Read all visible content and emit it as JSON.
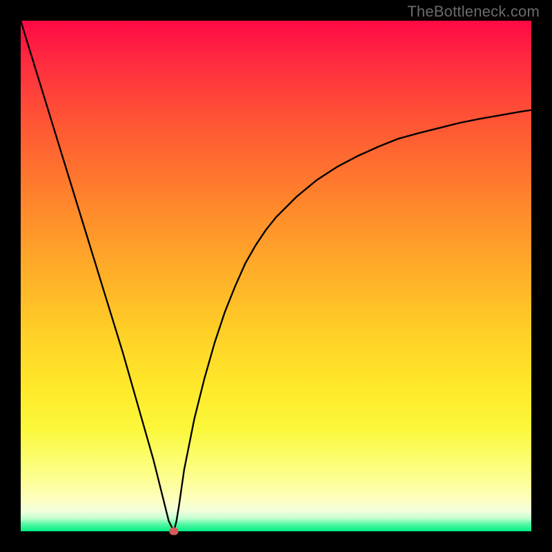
{
  "watermark": "TheBottleneck.com",
  "colors": {
    "page_bg": "#000000",
    "curve": "#000000",
    "marker": "#d65a5a",
    "gradient_top": "#fe0945",
    "gradient_bottom": "#00ee81"
  },
  "chart_data": {
    "type": "line",
    "title": "",
    "xlabel": "",
    "ylabel": "",
    "xlim": [
      0,
      100
    ],
    "ylim": [
      0,
      100
    ],
    "x": [
      0,
      2,
      4,
      6,
      8,
      10,
      12,
      14,
      16,
      18,
      20,
      22,
      24,
      26,
      27,
      28,
      28.5,
      29,
      29.5,
      30,
      30.5,
      31,
      32,
      34,
      36,
      38,
      40,
      42,
      44,
      46,
      48,
      50,
      54,
      58,
      62,
      66,
      70,
      74,
      78,
      82,
      86,
      90,
      94,
      98,
      100
    ],
    "y": [
      100,
      93.5,
      87,
      80.5,
      74,
      67.5,
      61,
      54.5,
      48,
      41.5,
      35,
      28,
      21,
      14,
      10,
      6,
      4,
      2,
      1,
      0,
      2,
      5,
      12,
      22,
      30,
      37,
      43,
      48,
      52.5,
      56,
      59,
      61.5,
      65.5,
      68.8,
      71.4,
      73.5,
      75.3,
      76.9,
      78,
      79,
      80,
      80.8,
      81.5,
      82.2,
      82.5
    ],
    "trough": {
      "x": 30,
      "y": 0
    }
  }
}
